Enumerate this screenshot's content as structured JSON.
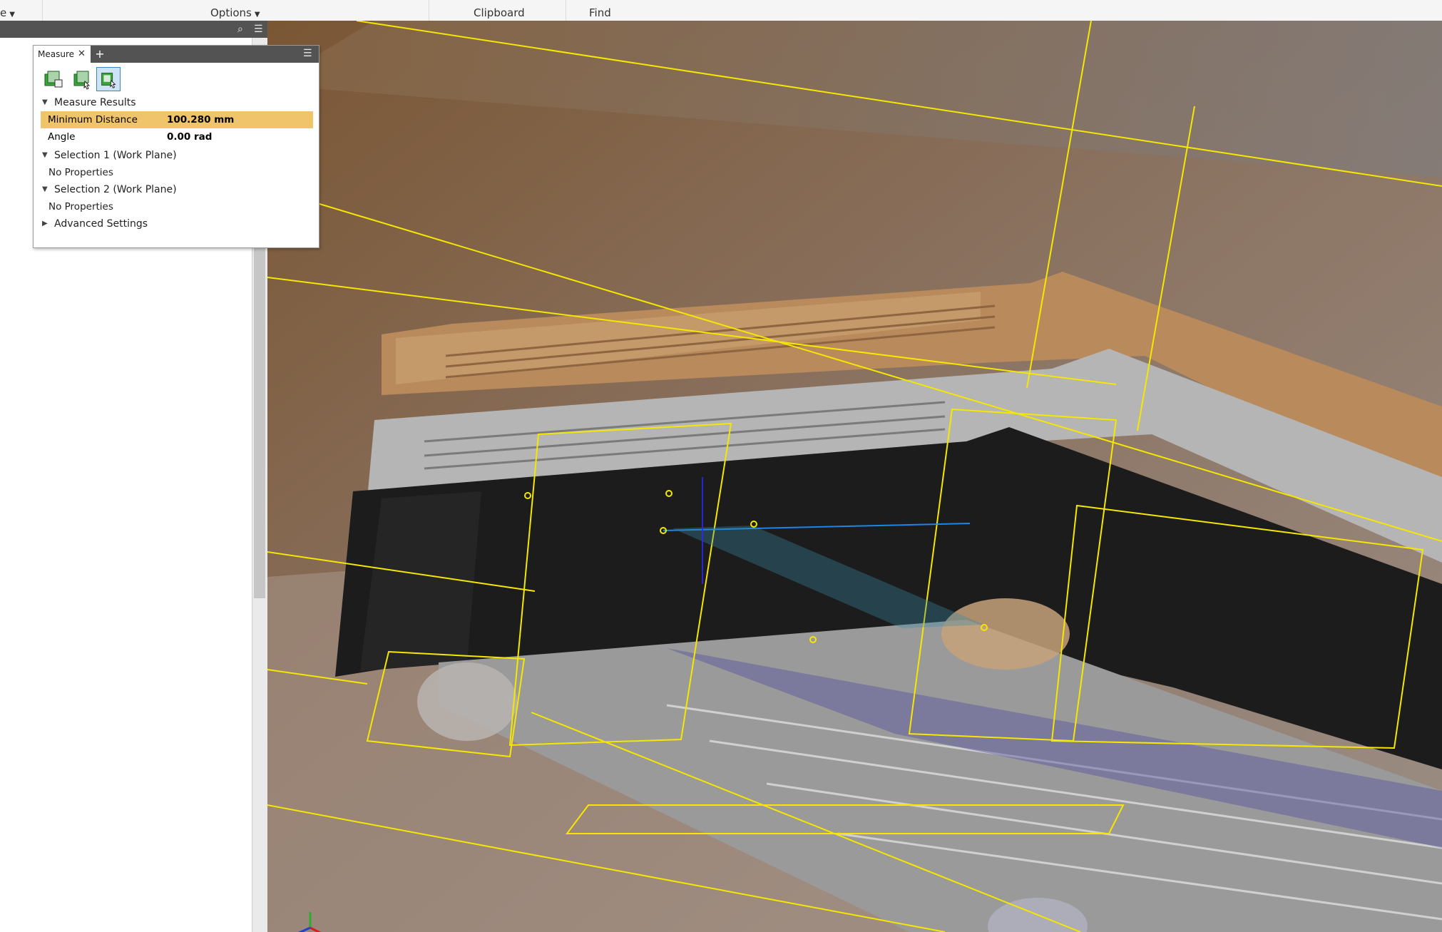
{
  "ribbon": {
    "groups": [
      {
        "label": "e"
      },
      {
        "label": "Options"
      },
      {
        "label": "Clipboard"
      },
      {
        "label": "Find"
      }
    ]
  },
  "browser": {
    "header_icons": [
      "search-icon",
      "menu-icon"
    ]
  },
  "measure": {
    "tab_label": "Measure",
    "plus_label": "+",
    "tools": [
      "measure-tool-1-icon",
      "measure-tool-2-icon",
      "measure-tool-3-icon"
    ],
    "results_title": "Measure Results",
    "results": [
      {
        "key": "Minimum Distance",
        "value": "100.280 mm",
        "highlighted": true
      },
      {
        "key": "Angle",
        "value": "0.00 rad",
        "highlighted": false
      }
    ],
    "selection1_title": "Selection 1 (Work Plane)",
    "selection1_text": "No Properties",
    "selection2_title": "Selection 2 (Work Plane)",
    "selection2_text": "No Properties",
    "advanced_title": "Advanced Settings"
  },
  "viewport": {
    "colors": {
      "work_plane": "#f5e700",
      "body_black": "#1c1c1c",
      "body_gray": "#a8a8a8",
      "wood": "#b88a5c"
    }
  }
}
